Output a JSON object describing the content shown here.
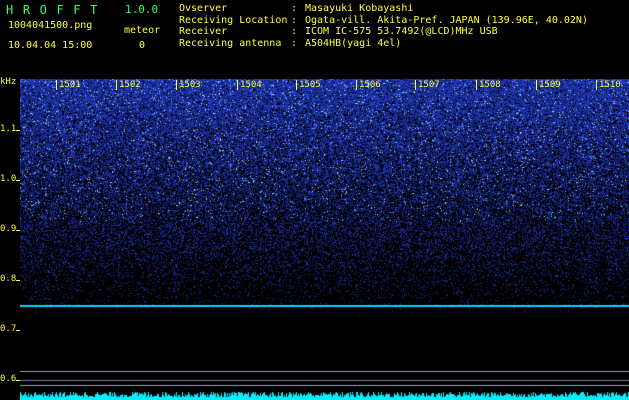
{
  "app": {
    "title": "HROFFT",
    "version": "1.0.0"
  },
  "file": {
    "name": "1004041500.png",
    "datetime": "10.04.04 15:00"
  },
  "meteor": {
    "label": "meteor",
    "count": "0"
  },
  "info": [
    {
      "key": "Ovserver",
      "value": "Masayuki Kobayashi"
    },
    {
      "key": "Receiving Location",
      "value": "Ogata-vill. Akita-Pref. JAPAN (139.96E, 40.02N)"
    },
    {
      "key": "Receiver",
      "value": "ICOM IC-575 53.7492(@LCD)MHz USB"
    },
    {
      "key": "Receiving antenna",
      "value": "A504HB(yagi 4el)"
    }
  ],
  "yaxis": {
    "unit": "kHz",
    "ticks": [
      "1.1",
      "1.0",
      "0.9",
      "0.8",
      "0.7",
      "0.6"
    ]
  },
  "xaxis": {
    "ticks": [
      "1501",
      "1502",
      "1503",
      "1504",
      "1505",
      "1506",
      "1507",
      "1508",
      "1509",
      "1510"
    ]
  },
  "colors": {
    "text": "#ffff33",
    "title": "#33ff66",
    "signal": "#00ffff",
    "noise_high": "#2a3cff",
    "background": "#000000"
  }
}
